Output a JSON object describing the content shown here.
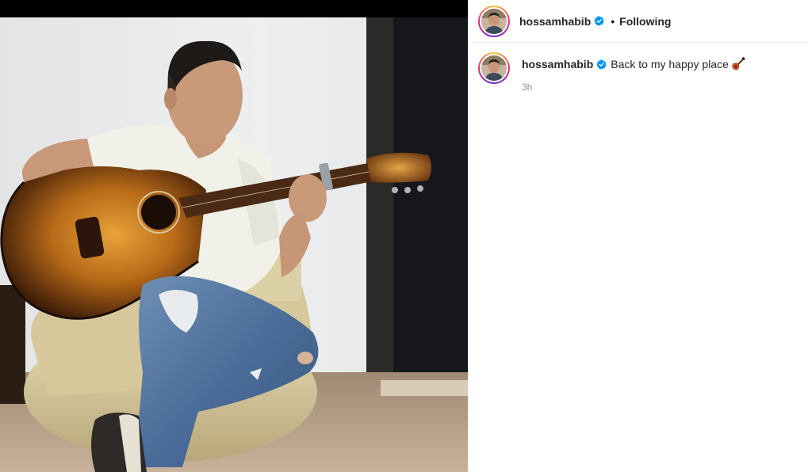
{
  "post": {
    "username": "hossamhabib",
    "follow_status": "Following",
    "separator": "•",
    "caption": "Back to my happy place",
    "emoji_icon": "guitar-emoji",
    "timestamp": "3h"
  },
  "icons": {
    "verified": "verified-badge-icon"
  },
  "colors": {
    "verified_blue": "#0095f6",
    "story_ring": [
      "#f9ce34",
      "#ee2a7b",
      "#6228d7"
    ],
    "muted_text": "#8e8e8e",
    "primary_text": "#262626"
  }
}
